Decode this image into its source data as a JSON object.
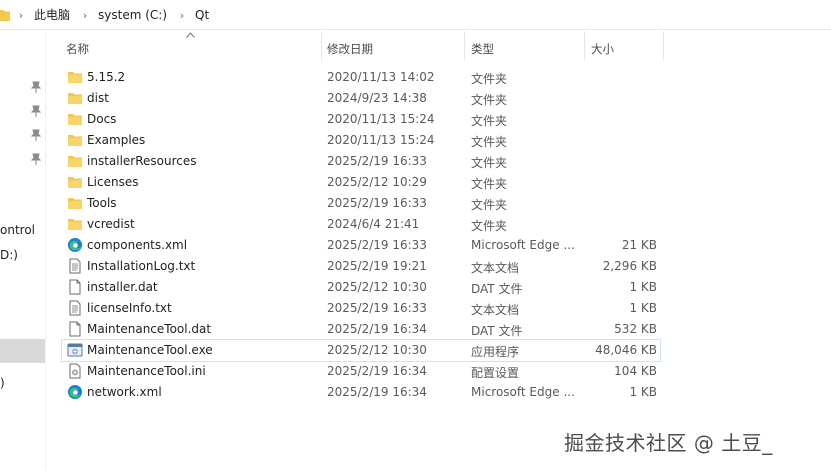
{
  "breadcrumbs": [
    "此电脑",
    "system (C:)",
    "Qt"
  ],
  "columns": {
    "name": "名称",
    "date": "修改日期",
    "type": "类型",
    "size": "大小"
  },
  "nav": {
    "partial_labels": [
      "ontrol",
      "D:)",
      ")"
    ]
  },
  "files": [
    {
      "name": "5.15.2",
      "date": "2020/11/13 14:02",
      "type": "文件夹",
      "size": "",
      "icon": "folder-icon"
    },
    {
      "name": "dist",
      "date": "2024/9/23 14:38",
      "type": "文件夹",
      "size": "",
      "icon": "folder-icon"
    },
    {
      "name": "Docs",
      "date": "2020/11/13 15:24",
      "type": "文件夹",
      "size": "",
      "icon": "folder-icon"
    },
    {
      "name": "Examples",
      "date": "2020/11/13 15:24",
      "type": "文件夹",
      "size": "",
      "icon": "folder-icon"
    },
    {
      "name": "installerResources",
      "date": "2025/2/19 16:33",
      "type": "文件夹",
      "size": "",
      "icon": "folder-icon"
    },
    {
      "name": "Licenses",
      "date": "2025/2/12 10:29",
      "type": "文件夹",
      "size": "",
      "icon": "folder-icon"
    },
    {
      "name": "Tools",
      "date": "2025/2/19 16:33",
      "type": "文件夹",
      "size": "",
      "icon": "folder-icon"
    },
    {
      "name": "vcredist",
      "date": "2024/6/4 21:41",
      "type": "文件夹",
      "size": "",
      "icon": "folder-icon"
    },
    {
      "name": "components.xml",
      "date": "2025/2/19 16:33",
      "type": "Microsoft Edge ...",
      "size": "21 KB",
      "icon": "edge-icon"
    },
    {
      "name": "InstallationLog.txt",
      "date": "2025/2/19 19:21",
      "type": "文本文档",
      "size": "2,296 KB",
      "icon": "text-file-icon"
    },
    {
      "name": "installer.dat",
      "date": "2025/2/12 10:30",
      "type": "DAT 文件",
      "size": "1 KB",
      "icon": "file-icon"
    },
    {
      "name": "licenseInfo.txt",
      "date": "2025/2/19 16:33",
      "type": "文本文档",
      "size": "1 KB",
      "icon": "text-file-icon"
    },
    {
      "name": "MaintenanceTool.dat",
      "date": "2025/2/19 16:34",
      "type": "DAT 文件",
      "size": "532 KB",
      "icon": "file-icon"
    },
    {
      "name": "MaintenanceTool.exe",
      "date": "2025/2/12 10:30",
      "type": "应用程序",
      "size": "48,046 KB",
      "icon": "exe-icon",
      "selected": true
    },
    {
      "name": "MaintenanceTool.ini",
      "date": "2025/2/19 16:34",
      "type": "配置设置",
      "size": "104 KB",
      "icon": "ini-icon"
    },
    {
      "name": "network.xml",
      "date": "2025/2/19 16:34",
      "type": "Microsoft Edge ...",
      "size": "1 KB",
      "icon": "edge-icon"
    }
  ],
  "watermark": "掘金技术社区 @ 土豆_",
  "colors": {
    "folder": "#f2c94c",
    "edge_blue": "#1b7fd6",
    "edge_green": "#3cc47c",
    "selection_border": "#cfe3f8"
  }
}
